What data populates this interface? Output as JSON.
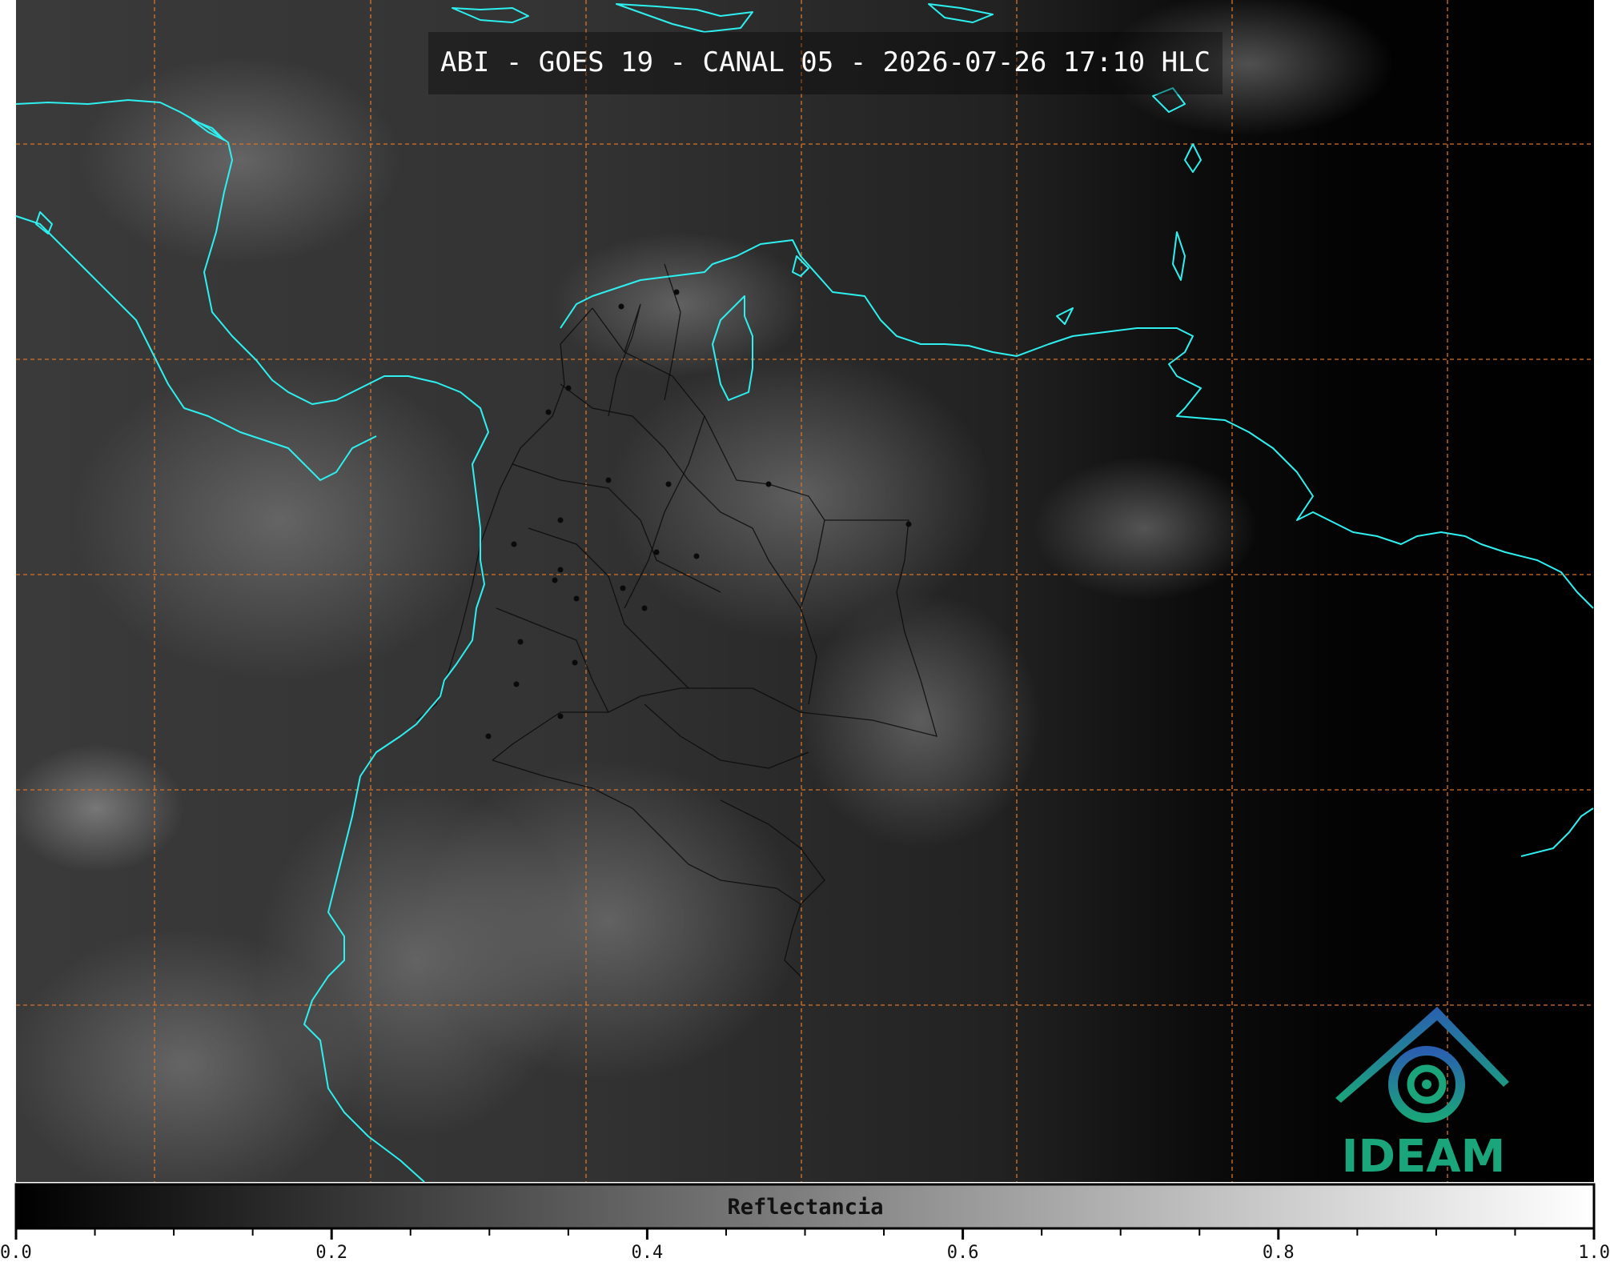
{
  "title": "ABI - GOES 19 - CANAL 05 - 2026-07-26 17:10 HLC",
  "colorbar": {
    "label": "Reflectancia",
    "min": 0.0,
    "max": 1.0,
    "ticks": [
      "0.0",
      "0.2",
      "0.4",
      "0.6",
      "0.8",
      "1.0"
    ],
    "colormap": [
      "#000000",
      "#ffffff"
    ]
  },
  "logo": {
    "text": "IDEAM",
    "colors": [
      "#2a5fb0",
      "#1aa57a"
    ]
  },
  "colors": {
    "coastline": "#2ef0f0",
    "grid": "#d6742a",
    "borders": "#0a0a0a"
  },
  "grid": {
    "style": "dashed"
  }
}
